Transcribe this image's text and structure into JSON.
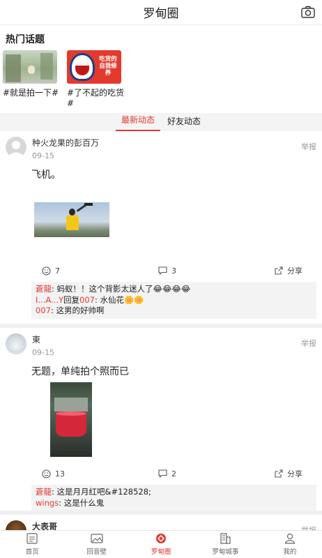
{
  "header": {
    "title": "罗甸圈"
  },
  "hot": {
    "title": "热门话题",
    "topics": [
      {
        "label": "#就是拍一下#"
      },
      {
        "label": "#了不起的吃货#",
        "overlay_text": "吃货的\n自我修养"
      }
    ]
  },
  "tabs": [
    {
      "label": "最新动态",
      "active": true
    },
    {
      "label": "好友动态",
      "active": false
    }
  ],
  "posts": [
    {
      "name": "种火龙果的彭百万",
      "date": "09-15",
      "report": "举报",
      "content": "飞机。",
      "likes": "7",
      "comments_count": "3",
      "share": "分享",
      "comments": [
        {
          "name": "蒼龍",
          "text": ": 蚂蚁！！这个背影太迷人了😂😂😂😂"
        },
        {
          "name": "I...A...Y",
          "reply": "回复",
          "to": "007",
          "text": ": 水仙花🌼🌼"
        },
        {
          "name": "007",
          "text": ": 这男的好帅啊"
        }
      ]
    },
    {
      "name": "東",
      "date": "09-15",
      "report": "举报",
      "content": "无题，单纯拍个照而已",
      "likes": "13",
      "comments_count": "2",
      "share": "分享",
      "comments": [
        {
          "name": "蒼龍",
          "text": ": 这是月月红吧&#128528;"
        },
        {
          "name": "wings",
          "text": ": 这是什么鬼"
        }
      ]
    },
    {
      "name": "大表哥",
      "report": "举报"
    }
  ],
  "tabbar": [
    {
      "label": "首页",
      "icon": "home-icon"
    },
    {
      "label": "回音壁",
      "icon": "image-icon"
    },
    {
      "label": "罗甸圈",
      "icon": "circle-icon",
      "active": true
    },
    {
      "label": "罗甸城事",
      "icon": "city-icon"
    },
    {
      "label": "我的",
      "icon": "user-icon"
    }
  ],
  "colors": {
    "accent": "#e03a32"
  }
}
